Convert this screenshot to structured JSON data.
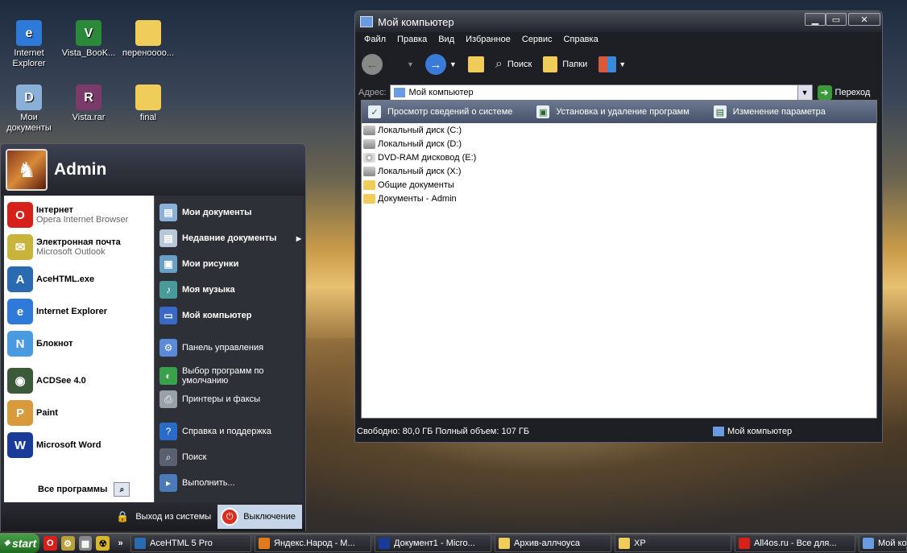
{
  "desktop": {
    "icons": [
      {
        "label": "Internet Explorer",
        "glyph": "e",
        "color": "#2f7ad8"
      },
      {
        "label": "Vista_BooK...",
        "glyph": "V",
        "color": "#2a8a3a"
      },
      {
        "label": "перенoooo...",
        "glyph": "",
        "color": "#f0cd5a"
      },
      {
        "label": "Мои документы",
        "glyph": "D",
        "color": "#8ab0d8"
      },
      {
        "label": "Vista.rar",
        "glyph": "R",
        "color": "#7a3a6a"
      },
      {
        "label": "final",
        "glyph": "",
        "color": "#f0cd5a"
      }
    ]
  },
  "start_menu": {
    "user": "Admin",
    "left_items": [
      {
        "title": "Інтернет",
        "subtitle": "Opera Internet Browser",
        "glyph": "O",
        "color": "#d8201a"
      },
      {
        "title": "Электронная почта",
        "subtitle": "Microsoft Outlook",
        "glyph": "✉",
        "color": "#c8b43a"
      },
      {
        "title": "AceHTML.exe",
        "subtitle": "",
        "glyph": "A",
        "color": "#2a6ab0"
      },
      {
        "title": "Internet Explorer",
        "subtitle": "",
        "glyph": "e",
        "color": "#2f7ad8"
      },
      {
        "title": "Блокнот",
        "subtitle": "",
        "glyph": "N",
        "color": "#4a9ae0"
      },
      {
        "title": "ACDSee 4.0",
        "subtitle": "",
        "glyph": "◉",
        "color": "#3a5a3a"
      },
      {
        "title": "Paint",
        "subtitle": "",
        "glyph": "P",
        "color": "#d89a3a"
      },
      {
        "title": "Microsoft Word",
        "subtitle": "",
        "glyph": "W",
        "color": "#1a3a9a"
      }
    ],
    "all_programs": "Все программы",
    "right_items": [
      {
        "label": "Мои документы",
        "bold": true,
        "glyph": "▤",
        "color": "#8ab0d8"
      },
      {
        "label": "Недавние документы",
        "bold": true,
        "glyph": "▤",
        "color": "#b8c8d8",
        "submenu": "▶"
      },
      {
        "label": "Мои рисунки",
        "bold": true,
        "glyph": "▣",
        "color": "#6aa0c8"
      },
      {
        "label": "Моя музыка",
        "bold": true,
        "glyph": "♪",
        "color": "#4a9a9a"
      },
      {
        "label": "Мой компьютер",
        "bold": true,
        "glyph": "▭",
        "color": "#3a6ac8"
      },
      {
        "label": "Панель управления",
        "bold": false,
        "glyph": "⚙",
        "color": "#5a8ad8"
      },
      {
        "label": "Выбор программ по умолчанию",
        "bold": false,
        "glyph": "◐",
        "color": "#3aa04a"
      },
      {
        "label": "Принтеры и факсы",
        "bold": false,
        "glyph": "⎙",
        "color": "#9aa0aa"
      },
      {
        "label": "Справка и поддержка",
        "bold": false,
        "glyph": "?",
        "color": "#2a6ac8"
      },
      {
        "label": "Поиск",
        "bold": false,
        "glyph": "⌕",
        "color": "#5a6070"
      },
      {
        "label": "Выполнить...",
        "bold": false,
        "glyph": "▸",
        "color": "#4a7ab8"
      }
    ],
    "logoff": "Выход из системы",
    "shutdown": "Выключение"
  },
  "window": {
    "title": "Мой компьютер",
    "menu": [
      "Файл",
      "Правка",
      "Вид",
      "Избранное",
      "Сервис",
      "Справка"
    ],
    "toolbar": {
      "search": "Поиск",
      "folders": "Папки"
    },
    "address_label": "Адрес:",
    "address_value": "Мой компьютер",
    "go_label": "Переход",
    "tasks": [
      "Просмотр сведений о системе",
      "Установка и удаление программ",
      "Изменение параметра"
    ],
    "items": [
      {
        "label": "Локальный диск (C:)",
        "kind": "disk"
      },
      {
        "label": "Локальный диск (D:)",
        "kind": "disk"
      },
      {
        "label": "DVD-RAM дисковод (E:)",
        "kind": "dvd"
      },
      {
        "label": "Локальный диск (X:)",
        "kind": "disk"
      },
      {
        "label": "Общие документы",
        "kind": "folder"
      },
      {
        "label": "Документы - Admin",
        "kind": "folder"
      }
    ],
    "status_left": "Свободно: 80,0 ГБ Полный объем: 107 ГБ",
    "status_right": "Мой компьютер"
  },
  "taskbar": {
    "start": "start",
    "more": "»",
    "buttons": [
      {
        "label": "AceHTML 5 Pro",
        "color": "#2a6ab0"
      },
      {
        "label": "Яндекс.Народ - М...",
        "color": "#e07a1a"
      },
      {
        "label": "Документ1 - Micro...",
        "color": "#1a3a9a"
      },
      {
        "label": "Архив-аллчоуса",
        "color": "#f0cd5a"
      },
      {
        "label": "XP",
        "color": "#f0cd5a"
      },
      {
        "label": "All4os.ru - Все для...",
        "color": "#d8201a"
      },
      {
        "label": "Мой комп",
        "color": "#6a9ae0"
      }
    ]
  }
}
